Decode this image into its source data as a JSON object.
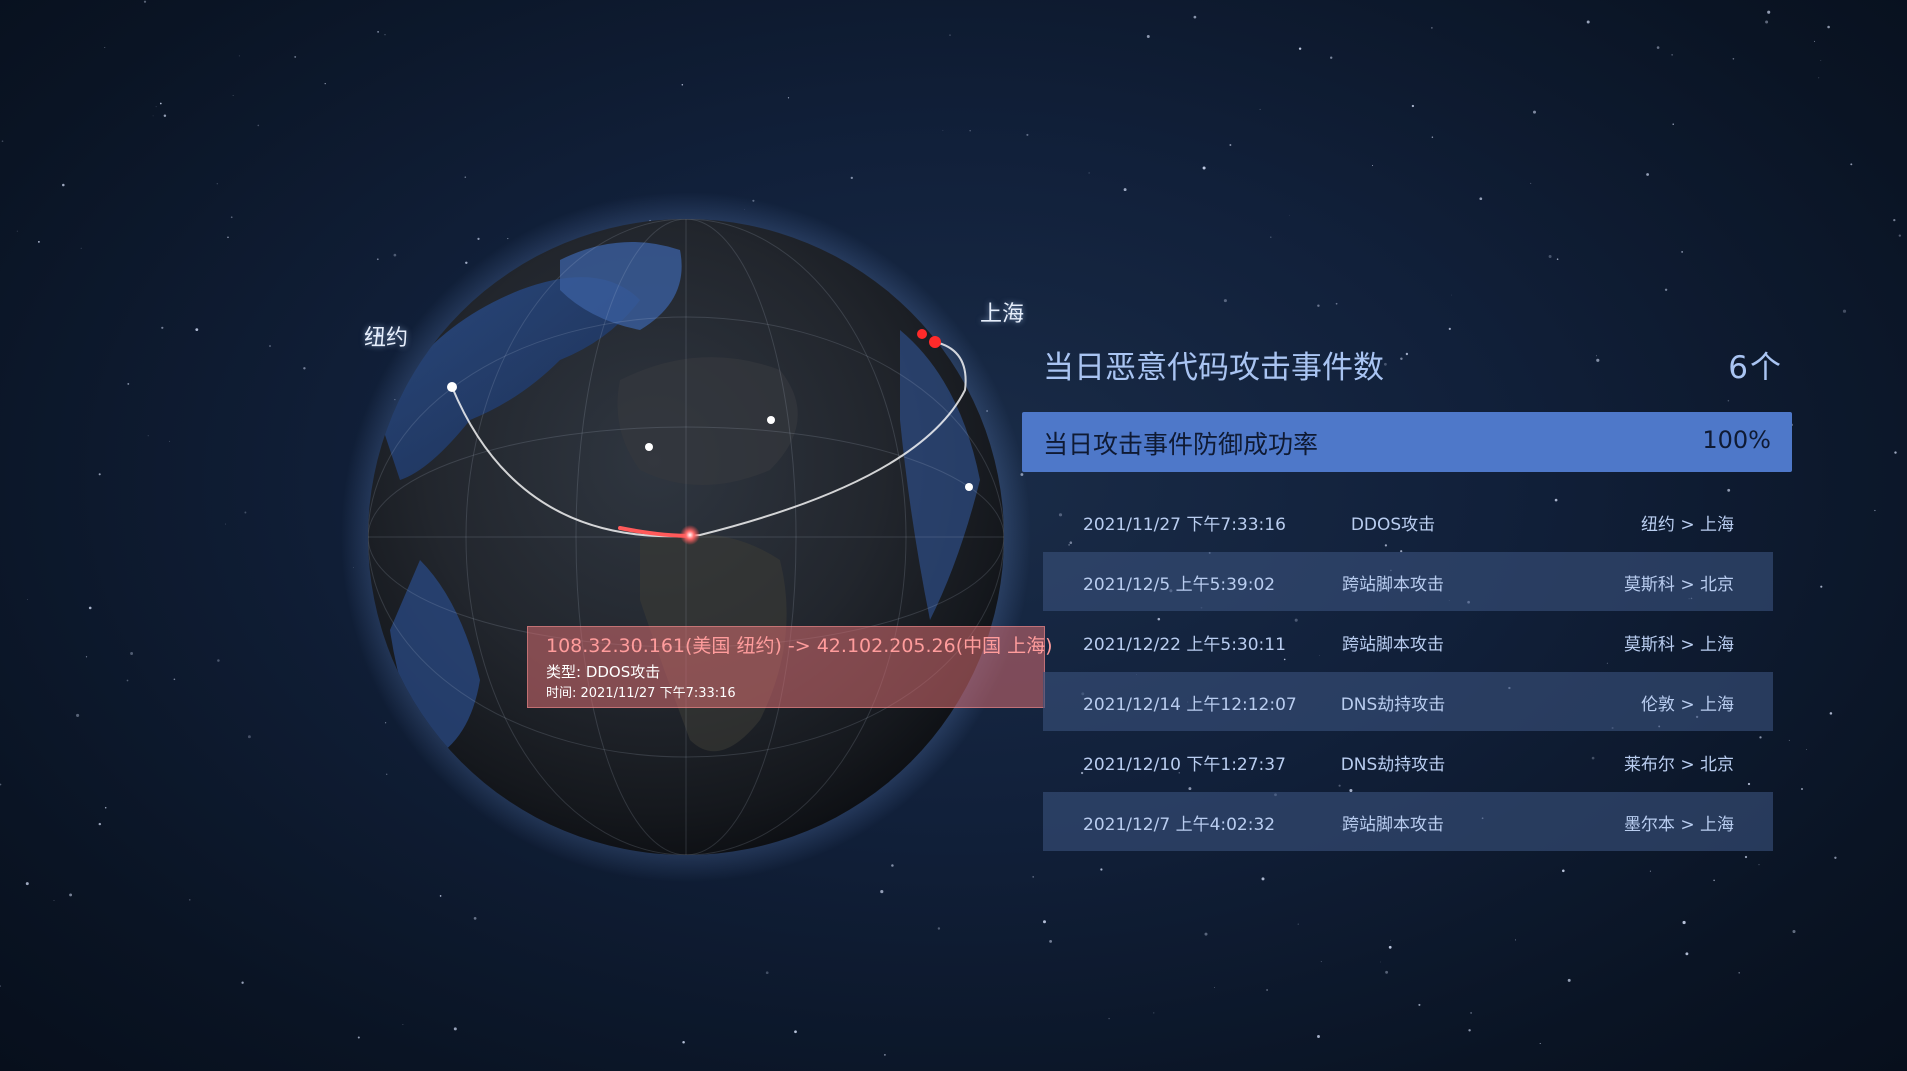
{
  "globe": {
    "cities": {
      "newyork": "纽约",
      "shanghai": "上海"
    },
    "tooltip": {
      "route": "108.32.30.161(美国 纽约) -> 42.102.205.26(中国 上海)",
      "type": "类型: DDOS攻击",
      "time": "时间: 2021/11/27 下午7:33:16"
    }
  },
  "panel": {
    "title": "当日恶意代码攻击事件数",
    "count": "6",
    "count_unit": "个",
    "defense_label": "当日攻击事件防御成功率",
    "defense_rate": "100%",
    "events": [
      {
        "time": "2021/11/27 下午7:33:16",
        "type": "DDOS攻击",
        "route": "纽约 > 上海"
      },
      {
        "time": "2021/12/5 上午5:39:02",
        "type": "跨站脚本攻击",
        "route": "莫斯科 > 北京"
      },
      {
        "time": "2021/12/22 上午5:30:11",
        "type": "跨站脚本攻击",
        "route": "莫斯科 > 上海"
      },
      {
        "time": "2021/12/14 上午12:12:07",
        "type": "DNS劫持攻击",
        "route": "伦敦 > 上海"
      },
      {
        "time": "2021/12/10 下午1:27:37",
        "type": "DNS劫持攻击",
        "route": "莱布尔 > 北京"
      },
      {
        "time": "2021/12/7 上午4:02:32",
        "type": "跨站脚本攻击",
        "route": "墨尔本 > 上海"
      }
    ]
  },
  "colors": {
    "accent": "#4e78c9",
    "panel_text": "#a9c4f2",
    "attack_arc": "#ff4d4d",
    "tooltip_bg": "#d66c70"
  }
}
